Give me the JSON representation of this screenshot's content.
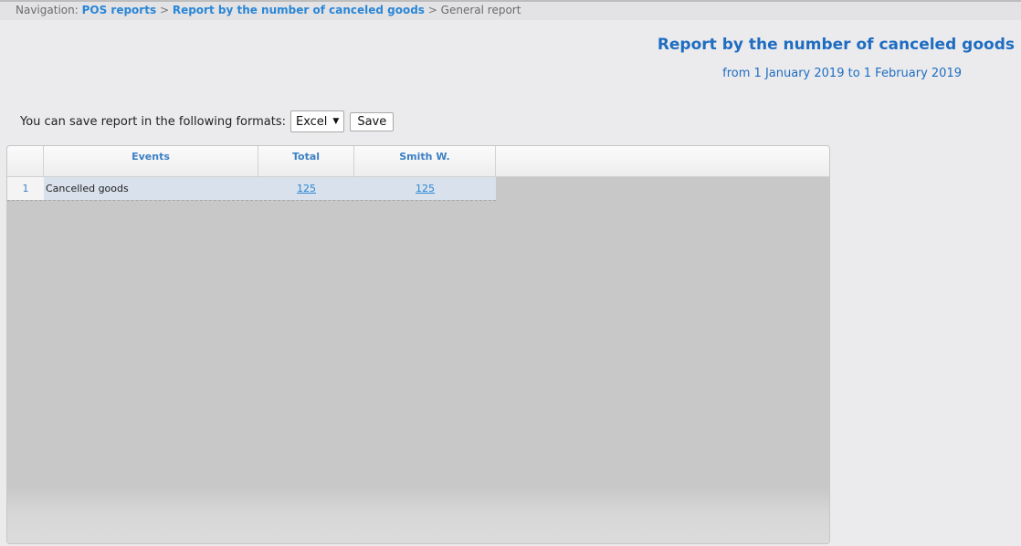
{
  "navigation": {
    "prefix": "Navigation:",
    "links": [
      "POS reports",
      "Report by the number of canceled goods"
    ],
    "current": "General report",
    "separator": ">"
  },
  "report": {
    "title": "Report by the number of canceled goods",
    "period": "from 1 January 2019 to 1 February 2019"
  },
  "save": {
    "label": "You can save report in the following formats:",
    "format_selected": "Excel",
    "button": "Save"
  },
  "table": {
    "columns": [
      "Events",
      "Total",
      "Smith W."
    ],
    "rows": [
      {
        "num": "1",
        "event": "Cancelled goods",
        "total": "125",
        "smith": "125"
      }
    ]
  },
  "colors": {
    "accent": "#1f6dc1",
    "link": "#2a86d6",
    "row_highlight": "#d8e1ec",
    "grid_background": "#c8c8c8"
  }
}
